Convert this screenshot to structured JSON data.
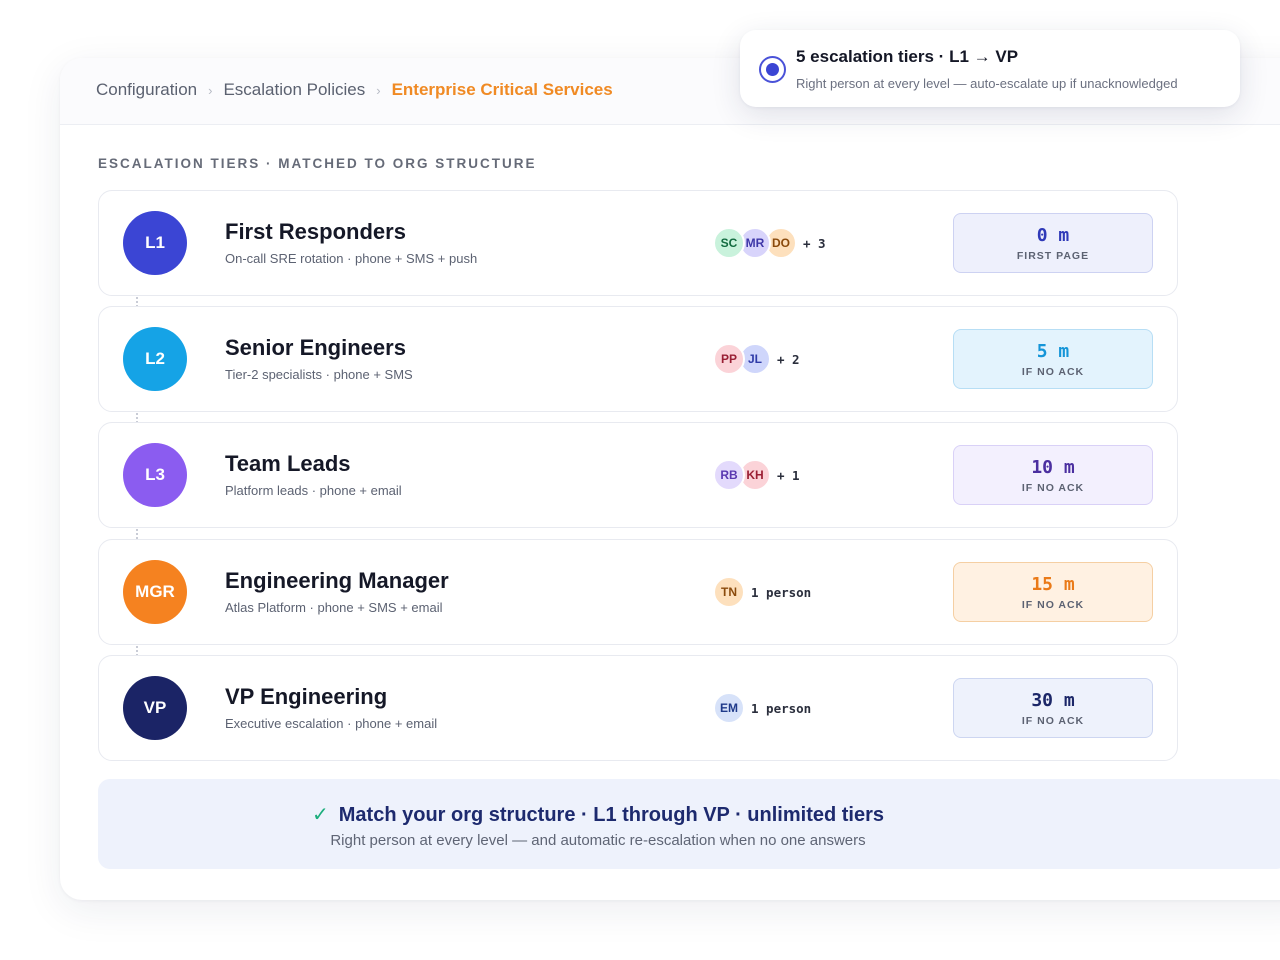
{
  "breadcrumb": {
    "items": [
      "Configuration",
      "Escalation Policies",
      "Enterprise Critical Services"
    ],
    "separator": "›"
  },
  "toast": {
    "title": "5 escalation tiers · L1 → VP",
    "subtitle": "Right person at every level — auto-escalate up if unacknowledged"
  },
  "section_label": "ESCALATION TIERS · MATCHED TO ORG STRUCTURE",
  "tiers": [
    {
      "badge": "L1",
      "badge_color": "#3b45d4",
      "name": "First Responders",
      "detail": "On-call SRE rotation · phone + SMS + push",
      "members": [
        {
          "initials": "SC",
          "bg": "#c9f2dc",
          "fg": "#136b40"
        },
        {
          "initials": "MR",
          "bg": "#d8d4fb",
          "fg": "#3e37a8"
        },
        {
          "initials": "DO",
          "bg": "#fde0bd",
          "fg": "#8a4a0c"
        }
      ],
      "extra": "+ 3",
      "delay": "0 m",
      "delay_label": "FIRST PAGE",
      "timer_bg": "#eef0fc",
      "timer_border": "#cdd2f2",
      "timer_color": "#2f39b8"
    },
    {
      "badge": "L2",
      "badge_color": "#15a3e6",
      "name": "Senior Engineers",
      "detail": "Tier-2 specialists · phone + SMS",
      "members": [
        {
          "initials": "PP",
          "bg": "#fbd3d8",
          "fg": "#9a1f34"
        },
        {
          "initials": "JL",
          "bg": "#cfd6fb",
          "fg": "#2f3ba8"
        }
      ],
      "extra": "+ 2",
      "delay": "5 m",
      "delay_label": "IF NO ACK",
      "timer_bg": "#e3f3fd",
      "timer_border": "#b7def5",
      "timer_color": "#1595d8"
    },
    {
      "badge": "L3",
      "badge_color": "#8b5cf0",
      "name": "Team Leads",
      "detail": "Platform leads · phone + email",
      "members": [
        {
          "initials": "RB",
          "bg": "#e3dafc",
          "fg": "#5a38b0"
        },
        {
          "initials": "KH",
          "bg": "#fbd3d8",
          "fg": "#9a1f34"
        }
      ],
      "extra": "+ 1",
      "delay": "10 m",
      "delay_label": "IF NO ACK",
      "timer_bg": "#f3f0fe",
      "timer_border": "#d9d1f7",
      "timer_color": "#4b2fa0"
    },
    {
      "badge": "MGR",
      "badge_color": "#f58220",
      "name": "Engineering Manager",
      "detail": "Atlas Platform · phone + SMS + email",
      "members": [
        {
          "initials": "TN",
          "bg": "#fde0bd",
          "fg": "#8a4a0c"
        }
      ],
      "extra": "1 person",
      "delay": "15 m",
      "delay_label": "IF NO ACK",
      "timer_bg": "#fff1e2",
      "timer_border": "#f5cfa3",
      "timer_color": "#ea7a18"
    },
    {
      "badge": "VP",
      "badge_color": "#1b2466",
      "name": "VP Engineering",
      "detail": "Executive escalation · phone + email",
      "members": [
        {
          "initials": "EM",
          "bg": "#d7e2f9",
          "fg": "#1f3a8a"
        }
      ],
      "extra": "1 person",
      "delay": "30 m",
      "delay_label": "IF NO ACK",
      "timer_bg": "#eef2fc",
      "timer_border": "#cdd6f1",
      "timer_color": "#1c2768"
    }
  ],
  "banner": {
    "check": "✓",
    "title": "Match your org structure · L1 through VP · unlimited tiers",
    "subtitle": "Right person at every level — and automatic re-escalation when no one answers"
  }
}
